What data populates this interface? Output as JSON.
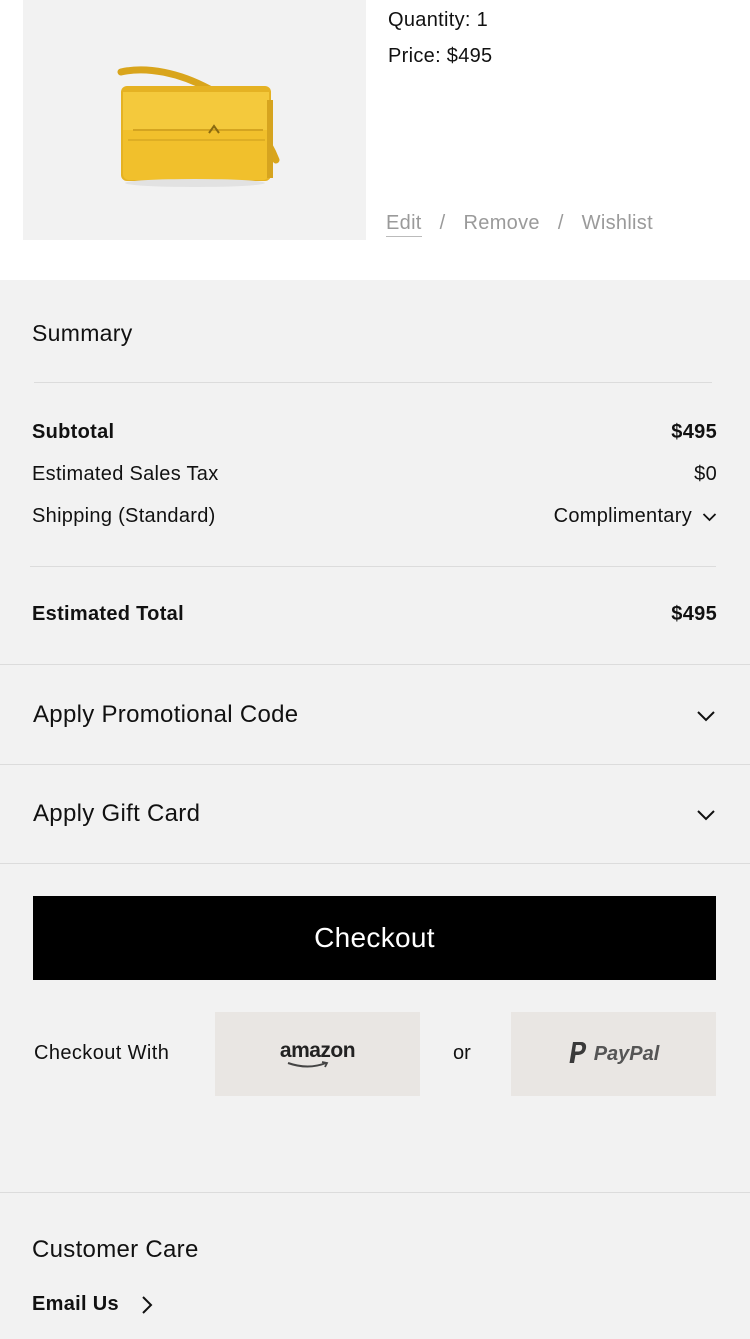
{
  "product": {
    "image_alt": "Yellow leather shoulder bag",
    "quantity": "Quantity: 1",
    "price": "Price: $495",
    "actions": {
      "edit": "Edit",
      "remove": "Remove",
      "wishlist": "Wishlist",
      "separator": "/"
    }
  },
  "summary": {
    "title": "Summary",
    "subtotal_label": "Subtotal",
    "subtotal_value": "$495",
    "tax_label": "Estimated Sales Tax",
    "tax_value": "$0",
    "shipping_label": "Shipping (Standard)",
    "shipping_value": "Complimentary",
    "total_label": "Estimated Total",
    "total_value": "$495"
  },
  "accordions": {
    "promo": "Apply Promotional Code",
    "gift_card": "Apply Gift Card"
  },
  "checkout": {
    "button_label": "Checkout",
    "with_label": "Checkout With",
    "amazon_label": "amazon",
    "or_label": "or",
    "paypal_label": "PayPal"
  },
  "customer_care": {
    "title": "Customer Care",
    "email_label": "Email Us"
  },
  "colors": {
    "accent": "#000000",
    "panel": "#f2f2f2",
    "pay_button": "#e9e6e3",
    "muted_text": "#9a9a9a",
    "bag_yellow": "#f1c02c"
  }
}
